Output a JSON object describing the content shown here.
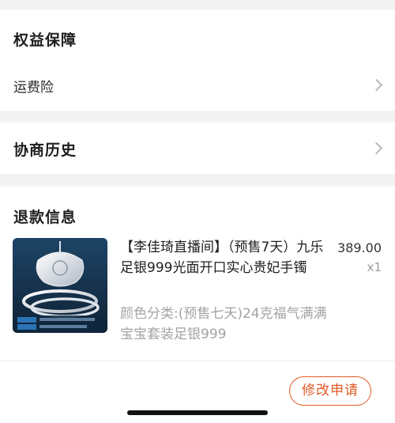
{
  "benefits": {
    "title": "权益保障",
    "shipping_insurance_label": "运费险"
  },
  "negotiation_history": {
    "title": "协商历史"
  },
  "refund_info": {
    "title": "退款信息",
    "product": {
      "title": "【李佳琦直播间】（预售7天）九乐足银999光面开口实心贵妃手镯",
      "price": "389.00",
      "quantity": "x1",
      "variant": "颜色分类:(预售七天)24克福气满满宝宝套装足银999"
    },
    "modify_button_label": "修改申请"
  },
  "colors": {
    "accent": "#e25b25",
    "background": "#f3f3f3",
    "secondary_text": "#a3a3a3"
  }
}
